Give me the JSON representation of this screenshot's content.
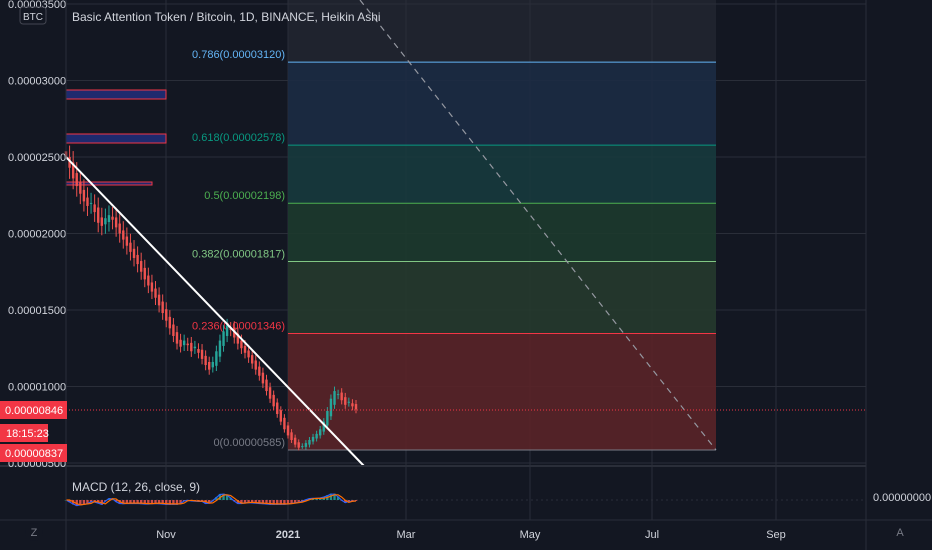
{
  "chart_data": {
    "type": "candlestick",
    "title": "Basic Attention Token / Bitcoin, 1D, BINANCE, Heikin Ashi",
    "currency_badge": "BTC",
    "y_axis": {
      "ticks": [
        "0.00003500",
        "0.00003000",
        "0.00002500",
        "0.00002000",
        "0.00001500",
        "0.00001000",
        "0.00000500"
      ],
      "ylim": [
        4.8e-06,
        3.52e-05
      ]
    },
    "x_axis": {
      "ticks": [
        "Nov",
        "2021",
        "Mar",
        "May",
        "Jul",
        "Sep"
      ]
    },
    "price_labels": {
      "last": "0.00000846",
      "countdown": "18:15:23",
      "low": "0.00000837"
    },
    "fibonacci": [
      {
        "label": "0(0.00000585)",
        "value": 5.85e-06,
        "color": "#787b86",
        "fill": "#5a2428"
      },
      {
        "label": "0.236(0.00001346)",
        "value": 1.346e-05,
        "color": "#f23645",
        "fill": "#5a2428"
      },
      {
        "label": "0.382(0.00001817)",
        "value": 1.817e-05,
        "color": "#81c784",
        "fill": "#263a2d"
      },
      {
        "label": "0.5(0.00002198)",
        "value": 2.198e-05,
        "color": "#4caf50",
        "fill": "#1d3a2e"
      },
      {
        "label": "0.618(0.00002578)",
        "value": 2.578e-05,
        "color": "#089981",
        "fill": "#173a3d"
      },
      {
        "label": "0.786(0.00003120)",
        "value": 3.12e-05,
        "color": "#64b5f6",
        "fill": "#1c2b44"
      }
    ],
    "price_series": [
      2.5e-05,
      2.43e-05,
      2.36e-05,
      2.31e-05,
      2.26e-05,
      2.21e-05,
      2.18e-05,
      2.2e-05,
      2.14e-05,
      2.07e-05,
      2.05e-05,
      2.1e-05,
      2.12e-05,
      2.09e-05,
      2.04e-05,
      2e-05,
      1.96e-05,
      1.92e-05,
      1.88e-05,
      1.84e-05,
      1.8e-05,
      1.75e-05,
      1.7e-05,
      1.66e-05,
      1.62e-05,
      1.58e-05,
      1.53e-05,
      1.48e-05,
      1.43e-05,
      1.38e-05,
      1.33e-05,
      1.28e-05,
      1.26e-05,
      1.3e-05,
      1.27e-05,
      1.23e-05,
      1.26e-05,
      1.22e-05,
      1.18e-05,
      1.14e-05,
      1.11e-05,
      1.16e-05,
      1.23e-05,
      1.3e-05,
      1.36e-05,
      1.4e-05,
      1.37e-05,
      1.32e-05,
      1.28e-05,
      1.25e-05,
      1.22e-05,
      1.19e-05,
      1.15e-05,
      1.11e-05,
      1.07e-05,
      1.02e-05,
      9.7e-06,
      9.2e-06,
      8.7e-06,
      8.2e-06,
      7.7e-06,
      7.2e-06,
      6.8e-06,
      6.5e-06,
      6.2e-06,
      6e-06,
      6.1e-06,
      6.3e-06,
      6.5e-06,
      6.7e-06,
      6.9e-06,
      7.2e-06,
      7.7e-06,
      8.4e-06,
      9.2e-06,
      9.7e-06,
      9.5e-06,
      9.1e-06,
      8.8e-06,
      9e-06,
      8.7e-06,
      8.5e-06
    ],
    "macd": {
      "label": "MACD (12, 26, close, 9)",
      "value_label": "0.00000000"
    },
    "scale_buttons": {
      "left": "Z",
      "right": "A"
    },
    "colors": {
      "background": "#131722",
      "grid": "#2a2e39",
      "up": "#26a69a",
      "down": "#ef5350",
      "trendline": "#ffffff",
      "price_line": "#f23645",
      "box_fill": "#1e2a6e",
      "box_border": "#f23645"
    }
  }
}
